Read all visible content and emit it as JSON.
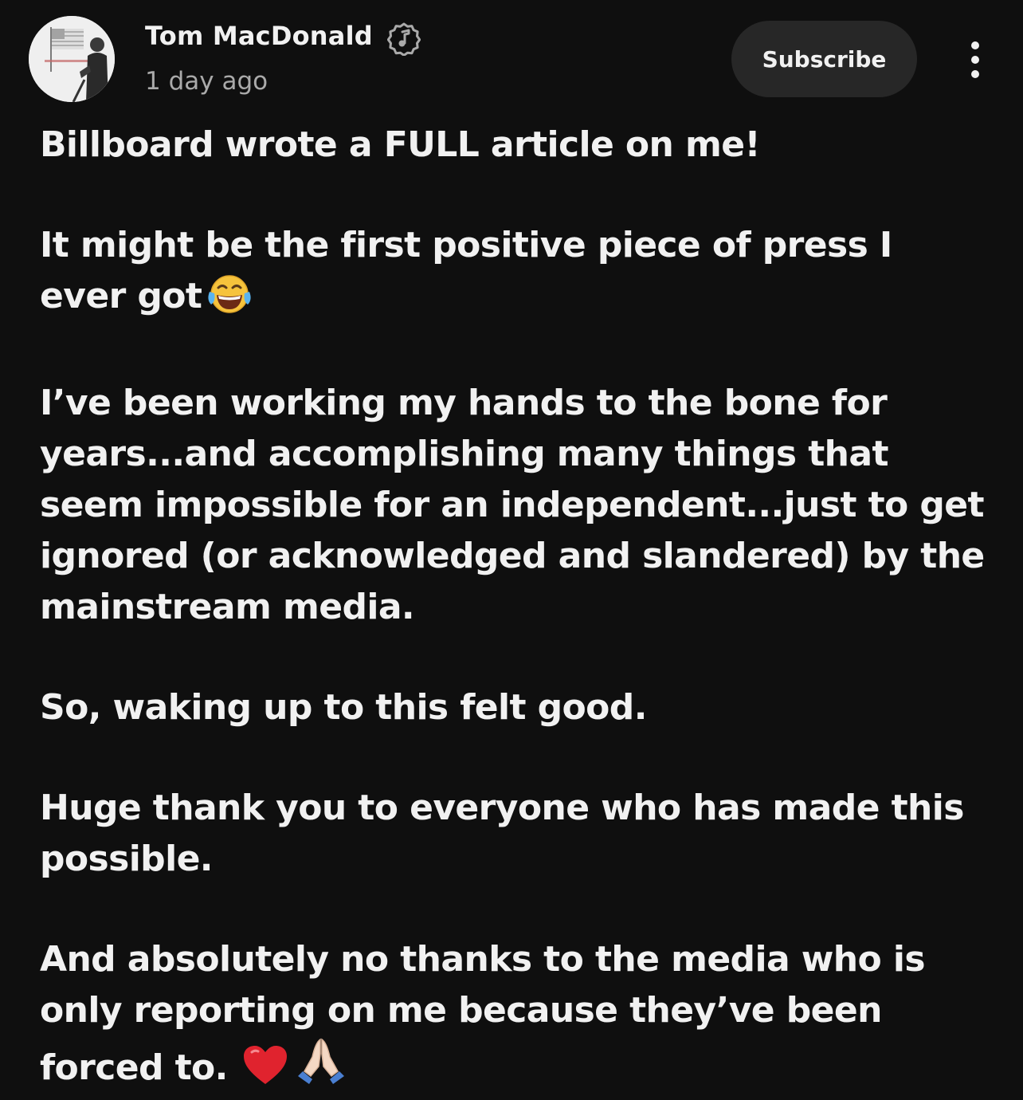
{
  "post": {
    "channel_name": "Tom MacDonald",
    "timestamp": "1 day ago",
    "subscribe_label": "Subscribe",
    "avatar_icon": "channel-avatar",
    "verified_icon": "music-artist-badge-icon",
    "more_icon": "more-vertical-icon",
    "paragraphs": [
      "Billboard wrote a FULL article on me!",
      "It might be the first positive piece of press I ever got",
      "I’ve been working my hands to the bone for years...and accomplishing many things that seem impossible for an independent...just to get ignored (or acknowledged and slandered) by the mainstream media.",
      "So, waking up to this felt good.",
      "Huge thank you to everyone who has made this possible.",
      "And absolutely no thanks to the media who is only reporting on me because they’ve been forced to."
    ],
    "emojis": {
      "laugh": "face-with-tears-of-joy",
      "heart": "red-heart",
      "pray": "folded-hands"
    }
  },
  "colors": {
    "background": "#0f0f0f",
    "text": "#f1f1f1",
    "secondary_text": "#aaaaaa",
    "button_bg": "#272727"
  }
}
